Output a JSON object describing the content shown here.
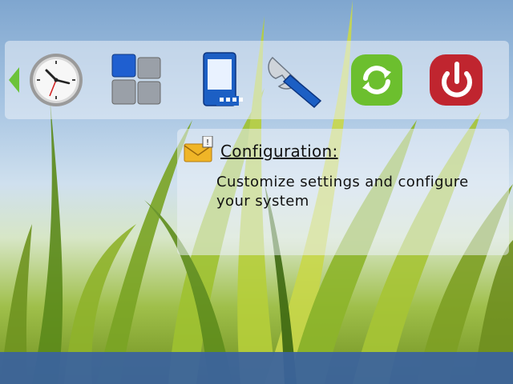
{
  "launcher": {
    "icons": [
      {
        "name": "clock-app",
        "icon": "clock-icon"
      },
      {
        "name": "apps-grid-app",
        "icon": "app-grid-icon"
      },
      {
        "name": "device-connectivity-app",
        "icon": "phone-connectivity-icon"
      },
      {
        "name": "configuration-app",
        "icon": "wrench-icon"
      },
      {
        "name": "sync-app",
        "icon": "refresh-icon"
      },
      {
        "name": "power-app",
        "icon": "power-icon"
      }
    ],
    "arrow_color": "#6cc33a"
  },
  "info_panel": {
    "title": "Configuration:",
    "description": "Customize settings and configure your system",
    "icon": "mail-alert-icon"
  },
  "colors": {
    "bottom_bar": "#3a629e",
    "sync_green": "#6cbf2e",
    "power_red": "#c0252f",
    "wrench_blue": "#1c5fc4"
  }
}
